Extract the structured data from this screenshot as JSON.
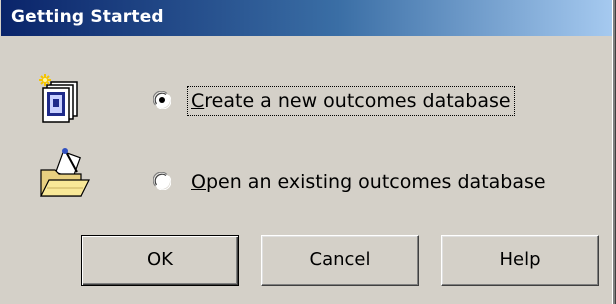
{
  "window": {
    "title": "Getting Started"
  },
  "options": {
    "new": {
      "label": "Create a new outcomes database",
      "selected": true,
      "icon": "new-document-icon"
    },
    "open": {
      "label": "Open an existing outcomes database",
      "selected": false,
      "icon": "open-folder-icon"
    }
  },
  "buttons": {
    "ok": "OK",
    "cancel": "Cancel",
    "help": "Help"
  },
  "colors": {
    "dialog_face": "#d4d0c8",
    "titlebar_start": "#0a246a",
    "titlebar_end": "#a6caf0"
  }
}
